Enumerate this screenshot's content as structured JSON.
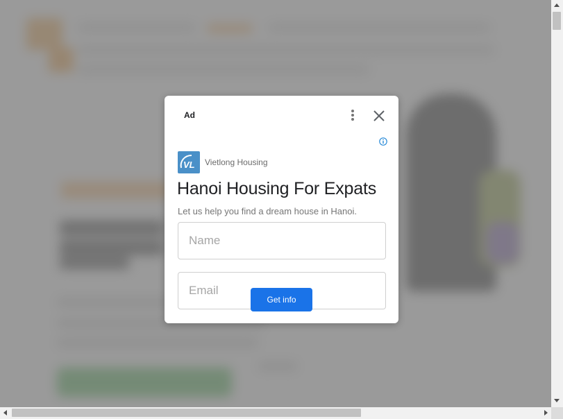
{
  "ad": {
    "label": "Ad",
    "menu_icon": "more-vertical-icon",
    "close_icon": "close-icon",
    "info_icon": "info-icon",
    "brand": {
      "logo_text": "VL",
      "logo_color": "#4a90c8",
      "name": "Vietlong Housing"
    },
    "headline": "Hanoi Housing For Expats",
    "subline": "Let us help you find a dream house in Hanoi.",
    "form": {
      "name_placeholder": "Name",
      "name_value": "",
      "email_placeholder": "Email",
      "email_value": ""
    },
    "cta_label": "Get info",
    "cta_color": "#1a73e8"
  },
  "background": {
    "overlay_color": "#808080",
    "accent_orange": "#eeb06a",
    "accent_green": "#4caf50"
  }
}
